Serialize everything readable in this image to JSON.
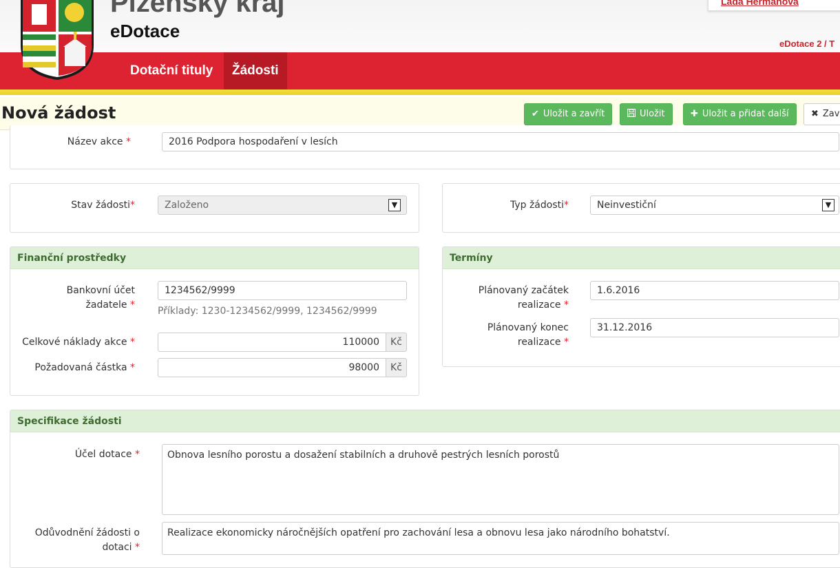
{
  "header": {
    "region_name": "Plzeňský kraj",
    "app_name": "eDotace",
    "user_name": "Lada Heřmanová",
    "version": "eDotace 2 / T"
  },
  "nav": {
    "items": [
      {
        "label": "Dotační tituly"
      },
      {
        "label": "Žádosti"
      }
    ]
  },
  "titlebar": {
    "title": "Nová žádost",
    "buttons": {
      "save_close": "Uložit a zavřít",
      "save": "Uložit",
      "save_add": "Uložit a přidat další",
      "close": "Zavřít"
    }
  },
  "form": {
    "nazev_akce": {
      "label": "Název akce",
      "value": "2016 Podpora hospodaření v lesích"
    },
    "stav_zadosti": {
      "label": "Stav žádosti",
      "value": "Založeno"
    },
    "typ_zadosti": {
      "label": "Typ žádosti",
      "value": "Neinvestiční"
    },
    "financni": {
      "heading": "Finanční prostředky",
      "bankovni_ucet": {
        "label_line1": "Bankovní účet",
        "label_line2": "žadatele",
        "value": "1234562/9999",
        "hint": "Příklady: 1230-1234562/9999, 1234562/9999"
      },
      "celkove_naklady": {
        "label": "Celkové náklady akce",
        "value": "110000",
        "unit": "Kč"
      },
      "pozadovana_castka": {
        "label": "Požadovaná částka",
        "value": "98000",
        "unit": "Kč"
      }
    },
    "terminy": {
      "heading": "Termíny",
      "zacatek": {
        "label_line1": "Plánovaný začátek",
        "label_line2": "realizace",
        "value": "1.6.2016"
      },
      "konec": {
        "label_line1": "Plánovaný konec",
        "label_line2": "realizace",
        "value": "31.12.2016"
      }
    },
    "specifikace": {
      "heading": "Specifikace žádosti",
      "ucel": {
        "label": "Účel dotace",
        "value": "Obnova lesního porostu a dosažení stabilních a druhově pestrých lesních porostů"
      },
      "oduvodneni": {
        "label_line1": "Odůvodnění žádosti o",
        "label_line2": "dotaci",
        "value": "Realizace ekonomicky náročnějších opatření pro zachování lesa a obnovu lesa jako národního bohatství."
      }
    },
    "required_mark": "*"
  },
  "colors": {
    "brand_red": "#dd2331",
    "stripe_yellow": "#f3df3d",
    "success_green": "#5cb85c",
    "panel_head": "#dff0d8"
  }
}
